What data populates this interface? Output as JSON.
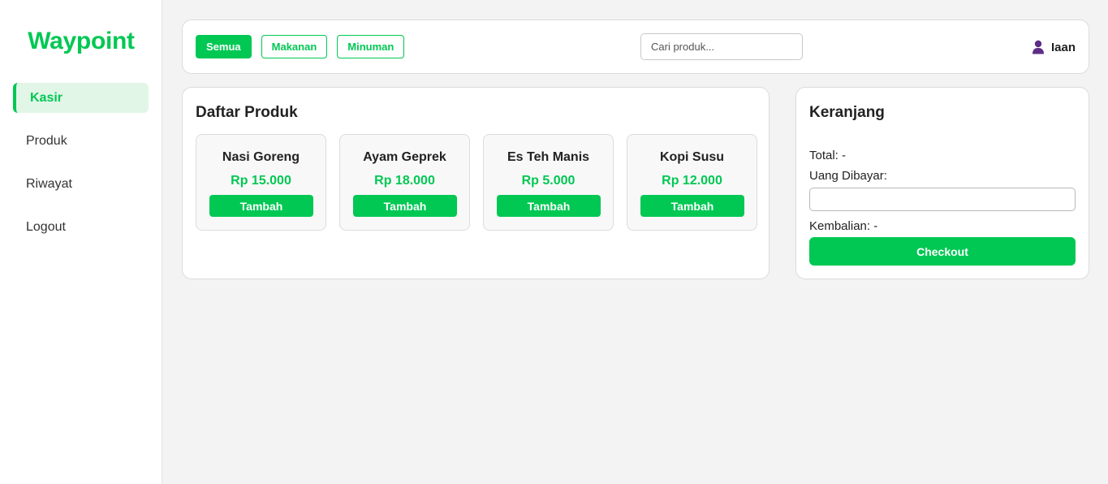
{
  "sidebar": {
    "brand": "Waypoint",
    "items": [
      {
        "label": "Kasir"
      },
      {
        "label": "Produk"
      },
      {
        "label": "Riwayat"
      },
      {
        "label": "Logout"
      }
    ]
  },
  "topbar": {
    "filters": [
      {
        "label": "Semua"
      },
      {
        "label": "Makanan"
      },
      {
        "label": "Minuman"
      }
    ],
    "search_placeholder": "Cari produk...",
    "user_name": "Iaan"
  },
  "products": {
    "title": "Daftar Produk",
    "add_label": "Tambah",
    "items": [
      {
        "name": "Nasi Goreng",
        "price": "Rp 15.000"
      },
      {
        "name": "Ayam Geprek",
        "price": "Rp 18.000"
      },
      {
        "name": "Es Teh Manis",
        "price": "Rp 5.000"
      },
      {
        "name": "Kopi Susu",
        "price": "Rp 12.000"
      }
    ]
  },
  "cart": {
    "title": "Keranjang",
    "total": "Total: -",
    "paid_label": "Uang Dibayar:",
    "change": "Kembalian: -",
    "checkout_label": "Checkout"
  },
  "colors": {
    "accent": "#00c853",
    "accent_light": "#e2f6e8",
    "user_icon": "#5e2d86"
  },
  "icons": {
    "user": "user-icon"
  }
}
